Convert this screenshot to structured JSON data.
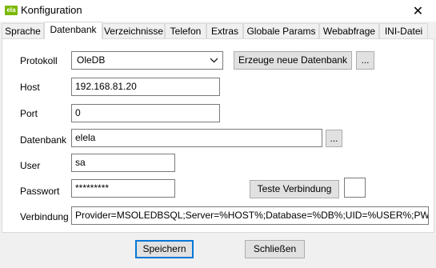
{
  "window": {
    "icon_text": "ela",
    "title": "Konfiguration",
    "close_glyph": "✕"
  },
  "tabs": [
    {
      "label": "Sprache"
    },
    {
      "label": "Datenbank",
      "active": true
    },
    {
      "label": "Verzeichnisse"
    },
    {
      "label": "Telefon"
    },
    {
      "label": "Extras"
    },
    {
      "label": "Globale Params"
    },
    {
      "label": "Webabfrage"
    },
    {
      "label": "INI-Datei"
    }
  ],
  "form": {
    "protokoll_label": "Protokoll",
    "protokoll_value": "OleDB",
    "erzeuge_button": "Erzeuge neue Datenbank",
    "ellipsis": "...",
    "host_label": "Host",
    "host_value": "192.168.81.20",
    "port_label": "Port",
    "port_value": "0",
    "datenbank_label": "Datenbank",
    "datenbank_value": "elela",
    "user_label": "User",
    "user_value": "sa",
    "passwort_label": "Passwort",
    "passwort_value": "*********",
    "teste_button": "Teste Verbindung",
    "verbindung_label": "Verbindung",
    "verbindung_value": "Provider=MSOLEDBSQL;Server=%HOST%;Database=%DB%;UID=%USER%;PWD=%"
  },
  "footer": {
    "save_button": "Speichern",
    "close_button": "Schließen"
  },
  "colors": {
    "app_icon": "#7ab800",
    "default_button_border": "#0078d7"
  }
}
